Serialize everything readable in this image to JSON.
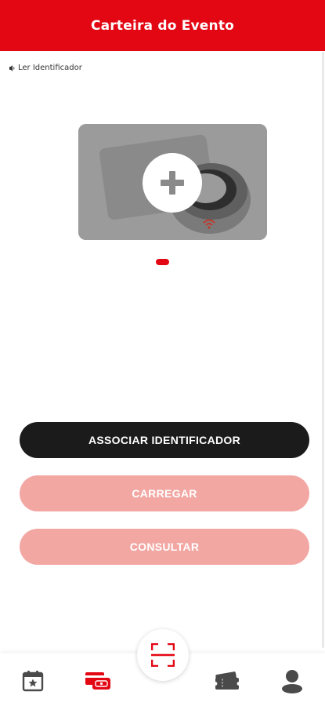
{
  "header": {
    "title": "Carteira do Evento"
  },
  "reader": {
    "label": "Ler Identificador",
    "icon": "nfc-icon"
  },
  "card": {
    "icon": "add-identifier-icon",
    "pager": {
      "count": 1,
      "active": 0
    }
  },
  "actions": {
    "associate_label": "ASSOCIAR IDENTIFICADOR",
    "load_label": "CARREGAR",
    "check_label": "CONSULTAR"
  },
  "bottom_nav": {
    "items": [
      {
        "name": "events",
        "icon": "calendar-star-icon",
        "active": false
      },
      {
        "name": "wallet",
        "icon": "wallet-icon",
        "active": true
      },
      {
        "name": "scan",
        "icon": "qr-scan-icon",
        "active": false
      },
      {
        "name": "tickets",
        "icon": "tickets-icon",
        "active": false
      },
      {
        "name": "profile",
        "icon": "user-icon",
        "active": false
      }
    ]
  },
  "colors": {
    "brand_red": "#e30613",
    "dark_button": "#1b1b1b",
    "disabled_button": "#f2a7a3",
    "icon_gray": "#4a4a4a"
  }
}
